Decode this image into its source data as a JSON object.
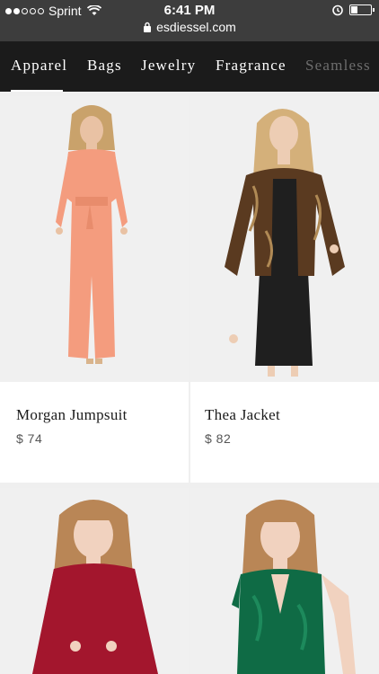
{
  "status": {
    "carrier": "Sprint",
    "time": "6:41 PM",
    "battery_level": 0.35,
    "url": "esdiessel.com"
  },
  "nav": {
    "tabs": [
      {
        "label": "Apparel",
        "active": true
      },
      {
        "label": "Bags"
      },
      {
        "label": "Jewelry"
      },
      {
        "label": "Fragrance"
      },
      {
        "label": "Seamless"
      }
    ]
  },
  "products": [
    {
      "name": "Morgan Jumpsuit",
      "price": "$ 74"
    },
    {
      "name": "Thea Jacket",
      "price": "$ 82"
    },
    {
      "name": "",
      "price": ""
    },
    {
      "name": "",
      "price": ""
    }
  ],
  "colors": {
    "nav_bg": "#1b1b1b",
    "status_bg": "#3d3d3d",
    "jumpsuit": "#f49c7e",
    "jacket": "#5a3a20",
    "red_dress": "#a3162d",
    "green_dress": "#0f6b45"
  }
}
